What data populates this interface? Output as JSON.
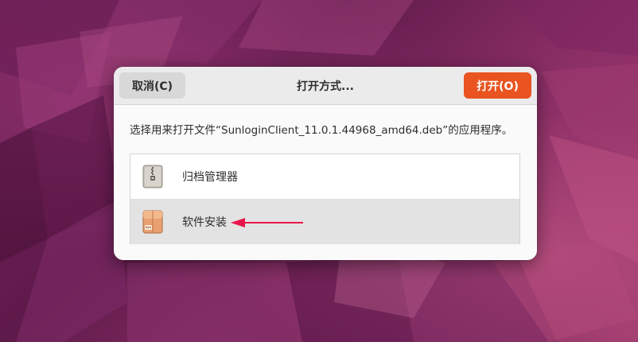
{
  "dialog": {
    "title": "打开方式...",
    "cancel_label": "取消(C)",
    "open_label": "打开(O)",
    "message": "选择用来打开文件“SunloginClient_11.0.1.44968_amd64.deb”的应用程序。",
    "accent_color": "#e95420"
  },
  "apps": [
    {
      "label": "归档管理器",
      "icon": "archive-manager-icon"
    },
    {
      "label": "软件安装",
      "icon": "software-install-icon",
      "selected": true
    }
  ],
  "annotation": {
    "arrow_color": "#e8174a"
  }
}
